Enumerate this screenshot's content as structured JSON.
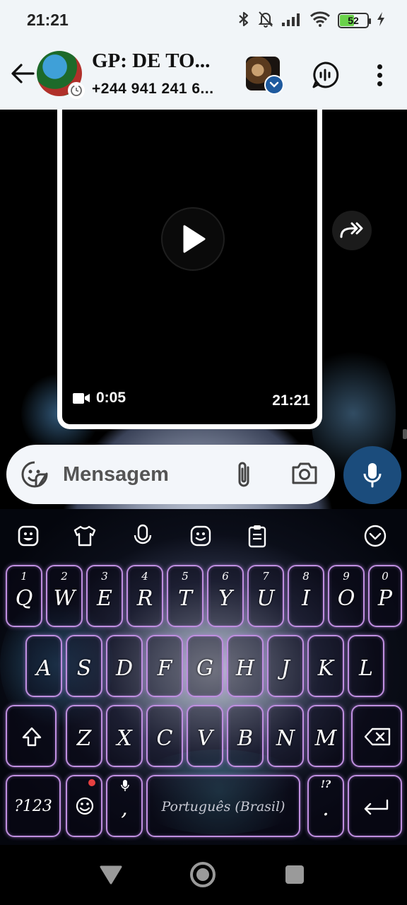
{
  "status_bar": {
    "time": "21:21",
    "battery": "52",
    "battery_level": 0.52
  },
  "header": {
    "title": "GP: DE TO...",
    "subtitle": "+244 941 241 6..."
  },
  "video_message": {
    "duration": "0:05",
    "time": "21:21"
  },
  "composer": {
    "placeholder": "Mensagem"
  },
  "keyboard": {
    "row1": [
      {
        "letter": "Q",
        "num": "1"
      },
      {
        "letter": "W",
        "num": "2"
      },
      {
        "letter": "E",
        "num": "3"
      },
      {
        "letter": "R",
        "num": "4"
      },
      {
        "letter": "T",
        "num": "5"
      },
      {
        "letter": "Y",
        "num": "6"
      },
      {
        "letter": "U",
        "num": "7"
      },
      {
        "letter": "I",
        "num": "8"
      },
      {
        "letter": "O",
        "num": "9"
      },
      {
        "letter": "P",
        "num": "0"
      }
    ],
    "row2": [
      "A",
      "S",
      "D",
      "F",
      "G",
      "H",
      "J",
      "K",
      "L"
    ],
    "row3": [
      "Z",
      "X",
      "C",
      "V",
      "B",
      "N",
      "M"
    ],
    "symbols_label": "?123",
    "comma": ",",
    "space_label": "Português (Brasil)",
    "period": ".",
    "period_hint": "!?"
  },
  "colors": {
    "header_bg": "#f1f5f8",
    "mic_button": "#1b4c7c",
    "key_border": "#c08fe0",
    "battery_fill": "#6ad24a"
  },
  "icons": {
    "status": [
      "bluetooth-icon",
      "mute-icon",
      "signal-icon",
      "wifi-icon",
      "battery-icon",
      "charging-icon"
    ],
    "header": [
      "back-arrow-icon",
      "voice-chat-icon",
      "more-vert-icon"
    ],
    "composer": [
      "sticker-icon",
      "paperclip-icon",
      "camera-icon",
      "mic-icon"
    ],
    "keyboard_toolbar": [
      "emoji-icon",
      "theme-shirt-icon",
      "voice-input-icon",
      "emoji-face-icon",
      "clipboard-icon",
      "collapse-icon"
    ]
  }
}
